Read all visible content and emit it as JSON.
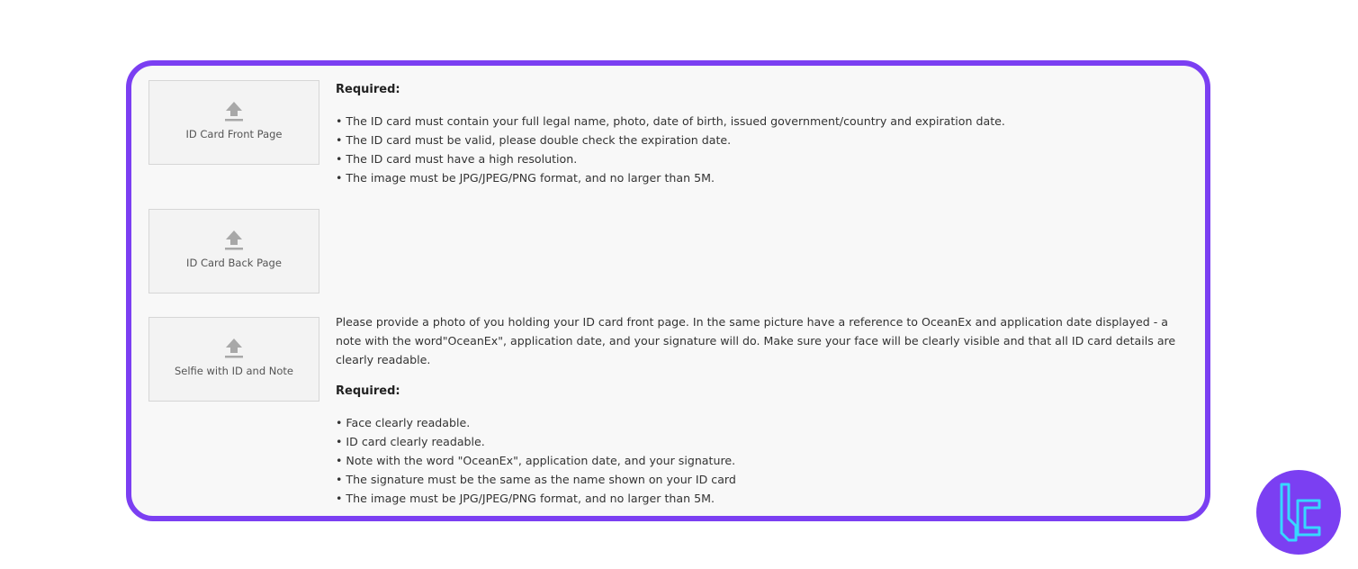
{
  "upload_boxes": [
    {
      "label": "ID Card Front Page",
      "icon": "upload-icon"
    },
    {
      "label": "ID Card Back Page",
      "icon": "upload-icon"
    },
    {
      "label": "Selfie with ID and Note",
      "icon": "upload-icon"
    }
  ],
  "front": {
    "required_label": "Required:",
    "items": [
      "• The ID card must contain your full legal name, photo, date of birth, issued government/country and expiration date.",
      "• The ID card must be valid, please double check the expiration date.",
      "• The ID card must have a high resolution.",
      "• The image must be JPG/JPEG/PNG format, and no larger than 5M."
    ]
  },
  "selfie": {
    "description": "Please provide a photo of you holding your ID card front page. In the same picture have a reference to OceanEx and application date displayed - a note with the word\"OceanEx\", application date, and your signature will do. Make sure your face will be clearly visible and that all ID card details are clearly readable.",
    "required_label": "Required:",
    "items": [
      "• Face clearly readable.",
      "• ID card clearly readable.",
      "• Note with the word \"OceanEx\", application date, and your signature.",
      "• The signature must be the same as the name shown on your ID card",
      "• The image must be JPG/JPEG/PNG format, and no larger than 5M."
    ]
  },
  "colors": {
    "frame_border": "#7b3ff2",
    "panel_bg": "#f8f8f8",
    "logo_bg": "#7b3ff2",
    "logo_stroke": "#37d7ff"
  }
}
